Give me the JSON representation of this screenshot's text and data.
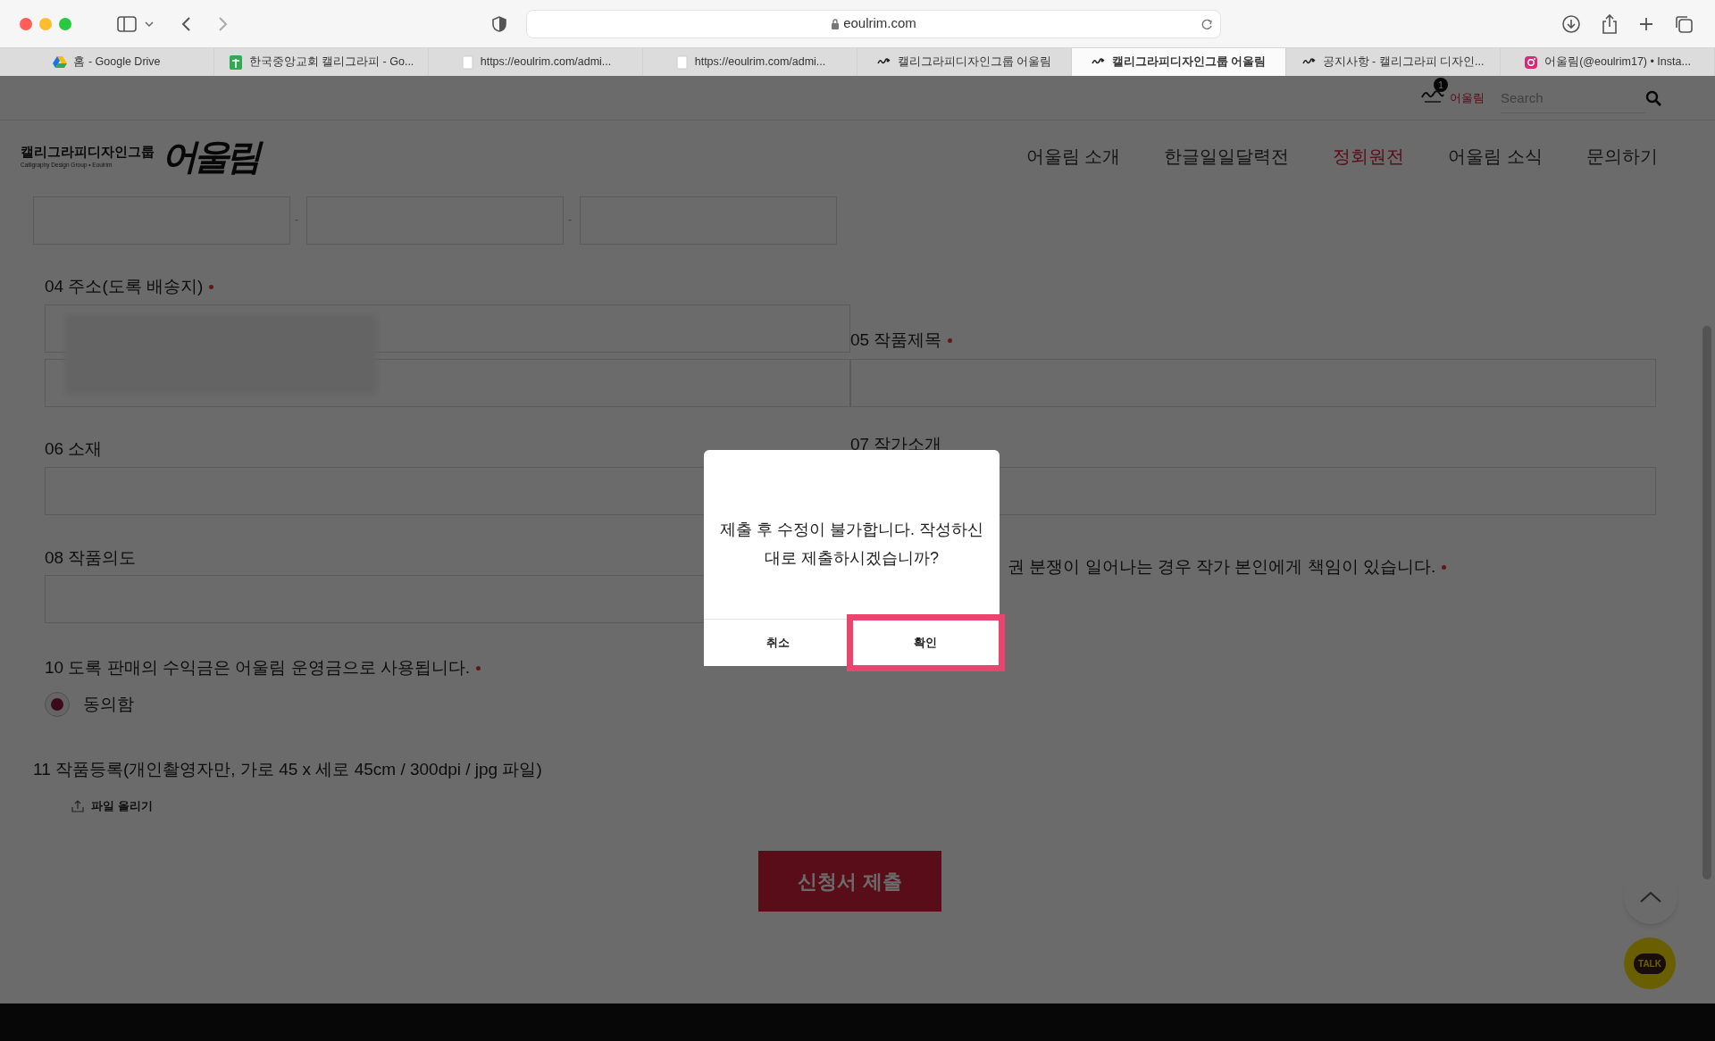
{
  "browser": {
    "address": "eoulrim.com",
    "tabs": [
      {
        "label": "홈 - Google Drive",
        "kind": "drive",
        "selected": false
      },
      {
        "label": "한국중앙교회 캘리그라피 - Go...",
        "kind": "sheets",
        "selected": false
      },
      {
        "label": "https://eoulrim.com/admi...",
        "kind": "page",
        "selected": false
      },
      {
        "label": "https://eoulrim.com/admi...",
        "kind": "page",
        "selected": false
      },
      {
        "label": "캘리그라피디자인그룹 어울림",
        "kind": "site",
        "selected": false
      },
      {
        "label": "캘리그라피디자인그룹 어울림",
        "kind": "site",
        "selected": true
      },
      {
        "label": "공지사항 - 캘리그라피 디자인...",
        "kind": "site",
        "selected": false
      },
      {
        "label": "어울림(@eoulrim17) • Insta...",
        "kind": "instagram",
        "selected": false
      }
    ]
  },
  "site": {
    "topbar": {
      "badge": "1",
      "user": "어울림",
      "search_placeholder": "Search"
    },
    "logo": {
      "group": "캘리그라피디자인그룹",
      "tagline": "Calligraphy Design Group • Eoulrim",
      "brand": "어울림"
    },
    "nav": [
      {
        "label": "어울림 소개",
        "selected": false
      },
      {
        "label": "한글일일달력전",
        "selected": false
      },
      {
        "label": "정회원전",
        "selected": true
      },
      {
        "label": "어울림 소식",
        "selected": false
      },
      {
        "label": "문의하기",
        "selected": false
      }
    ]
  },
  "form": {
    "phone_separators": [
      "-",
      "-"
    ],
    "address_label": "04 주소(도록 배송지)",
    "title_label": "05 작품제목",
    "material_label": "06 소재",
    "artist_label": "07 작가소개",
    "intent_label": "08 작품의도",
    "notice_09": "권 분쟁이 일어나는 경우 작가 본인에게 책임이 있습니다.",
    "consent_label": "10 도록 판매의 수익금은 어울림 운영금으로 사용됩니다.",
    "consent_option": {
      "label": "동의함",
      "checked": true
    },
    "upload_label": "11 작품등록(개인촬영자만, 가로 45 x 세로 45cm / 300dpi / jpg 파일)",
    "upload_button": "파일 올리기",
    "submit": "신청서 제출"
  },
  "dialog": {
    "message": "제출 후 수정이 불가합니다. 작성하신 대로 제출하시겠습니까?",
    "buttons": [
      {
        "label": "취소",
        "highlighted": false
      },
      {
        "label": "확인",
        "highlighted": true
      }
    ]
  },
  "talk_button": "TALK"
}
